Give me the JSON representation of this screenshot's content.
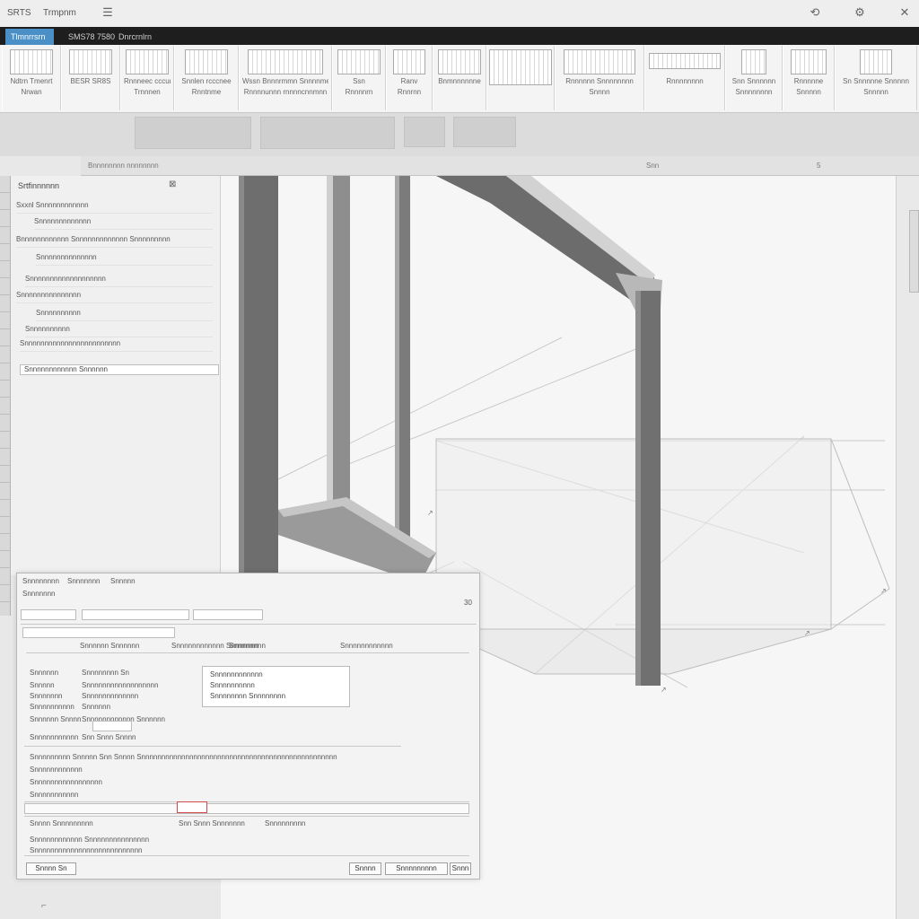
{
  "app": {
    "title_left": "SRTS",
    "title_mid": "Trmpnm",
    "menu_icons": [
      "undo-icon",
      "settings-icon",
      "tools-icon"
    ]
  },
  "tabs": [
    {
      "label": "Tlmnrrsrn 3",
      "active": true
    },
    {
      "label": "SMS78 7580",
      "active": false
    },
    {
      "label": "Dnrcrnlrn",
      "active": false
    }
  ],
  "ribbon": [
    {
      "label": "Ndtrn Tmenrt",
      "sub": "Nrwan"
    },
    {
      "label": "BESR SR8S",
      "sub": ""
    },
    {
      "label": "Rnnneec cccunm",
      "sub": "Trnnnen"
    },
    {
      "label": "Snnlen rcccnee",
      "sub": "Rnntnme"
    },
    {
      "label": "Wssn Bnnnrmmn Snnnnme",
      "sub": "Rnnnnunnn rnnnncnnmnn"
    },
    {
      "label": "Ssn",
      "sub": "Rnnnnrn"
    },
    {
      "label": "Ranv",
      "sub": "Rnnrnn"
    },
    {
      "label": "Bnmnnnnnne",
      "sub": ""
    },
    {
      "label": "",
      "sub": ""
    },
    {
      "label": "Rnnnnnn Snnnnnnnn",
      "sub": "Snnnn"
    },
    {
      "label": "Rnnnnnnnn",
      "sub": ""
    },
    {
      "label": "Snn Snnnnnn",
      "sub": "Snnnnnnnn"
    },
    {
      "label": "Rnnnnne",
      "sub": "Snnnnn"
    },
    {
      "label": "Sn Snnnnne Snnnnn",
      "sub": "Snnnnn"
    }
  ],
  "strip2": {
    "left": "Bnnnnnnnn nnnnnnnn",
    "mid": "Snn",
    "right": "5"
  },
  "properties": {
    "title": "Srtfinnnnnn",
    "rows": [
      "Sxxnl Snnnnnnnnnnnn",
      "Snnnnnnnnnnnnn",
      "Bnnnnnnnnnnnn Snnnnnnnnnnnnn Snnnnnnnnn",
      "Snnnnnnnnnnnnnn",
      "Snnnnnnnnnnnnnnnnnnn",
      "Snnnnnnnnnnnnnnn",
      "Snnnnnnnnnn",
      "Snnnnnnnnnn",
      "Snnnnnnnnnnnnnnnnnnnnnnnn"
    ],
    "field_value": "Snnnnnnnnnnnn Snnnnnn"
  },
  "dialog": {
    "tabs": [
      "Snnnnnnnn",
      "Snnnnnnn",
      "Snnnnn"
    ],
    "subtitle": "Snnnnnnn",
    "scale_value": "30",
    "header_cols": [
      "Snnnnnn Snnnnnn",
      "Snnnnnnnnnnnn Snnnnnnn",
      "Snnnnnnnn",
      "Snnnnnnnnnnnn"
    ],
    "rows": [
      {
        "label": "Snnnnnn",
        "value": "Snnnnnnnn Sn"
      },
      {
        "label": "Snnnnn",
        "value": "Snnnnnnnnnnnnnnnnnn"
      },
      {
        "label": "Snnnnnnn",
        "value": "Snnnnnnnnnnnnn"
      },
      {
        "label": "Snnnnnnnnnn",
        "value": "Snnnnnn"
      },
      {
        "label": "Snnnnnn Snnnn",
        "value": "Snnnnnnnnnnnn Snnnnnn"
      },
      {
        "label": "Snnnnnnnnnnn",
        "value": "Snn Snnn Snnnn"
      }
    ],
    "popup_items": [
      "Snnnnnnnnnnnn",
      "Snnnnnnnnnn",
      "Snnnnnnnn Snnnnnnnn"
    ],
    "long_line": "Snnnnnnnnn Snnnnn Snn Snnnn Snnnnnnnnnnnnnnnnnnnnnnnnnnnnnnnnnnnnnnnnnnnnnnnnn",
    "section_a": "Snnnnnnnnnnnn",
    "section_b": "Snnnnnnnnnnnnnnnnn",
    "section_c": "Snnnnnnnnnnn",
    "footer_row": [
      "Snnnn Snnnnnnnnn",
      "Snn Snnn Snnnnnnn",
      "Snnnnnnnnn"
    ],
    "notes": [
      "Snnnnnnnnnnnn Snnnnnnnnnnnnnnn",
      "Snnnnnnnnnnnnnnnnnnnnnnnnnnn"
    ],
    "buttons": {
      "left": "Snnnn Sn",
      "ok": "Snnnn",
      "apply": "Snnnnnnnnn",
      "cancel": "Snnn"
    }
  },
  "colors": {
    "accent_tab": "#4a8fc6",
    "beam": "#6f6f6f",
    "highlight": "#d34a4a"
  }
}
